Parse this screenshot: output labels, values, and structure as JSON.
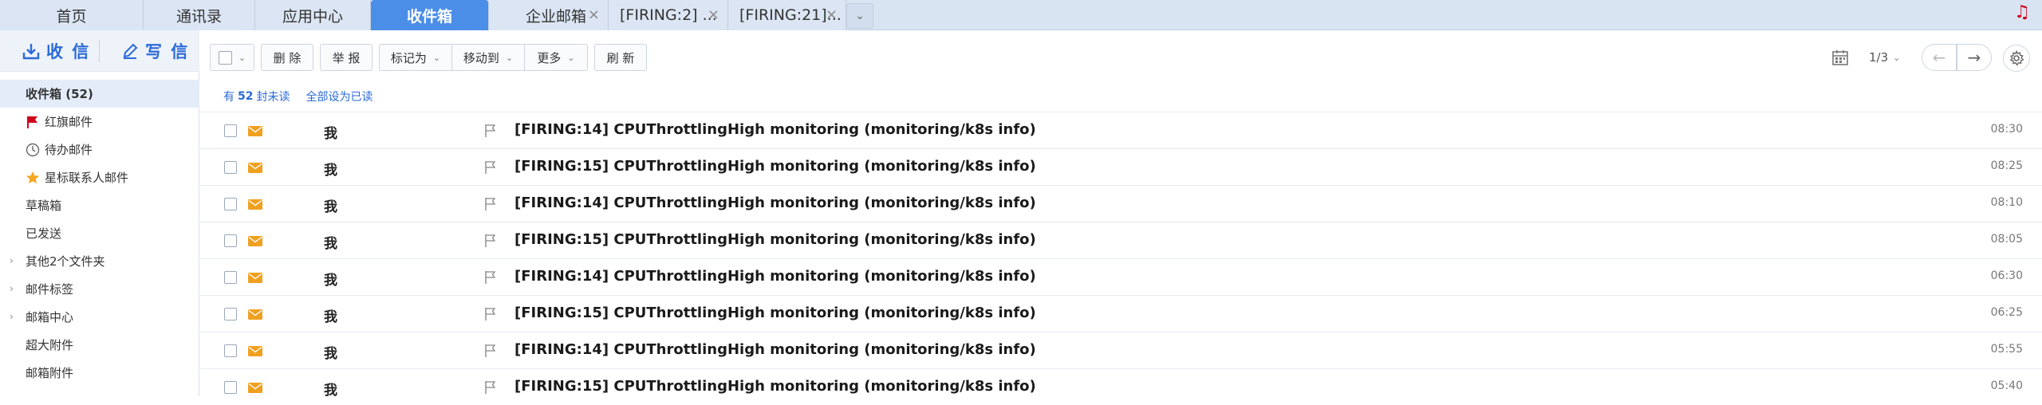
{
  "tabs": [
    {
      "label": "首页"
    },
    {
      "label": "通讯录"
    },
    {
      "label": "应用中心"
    },
    {
      "label": "收件箱"
    },
    {
      "label": "企业邮箱"
    },
    {
      "label": "[FIRING:2] ..."
    },
    {
      "label": "[FIRING:21]..."
    }
  ],
  "tab_close_glyph": "×",
  "compose": {
    "receive_label": "收 信",
    "write_label": "写 信"
  },
  "folders": [
    {
      "label": "收件箱 (52)"
    },
    {
      "label": "红旗邮件"
    },
    {
      "label": "待办邮件"
    },
    {
      "label": "星标联系人邮件"
    },
    {
      "label": "草稿箱"
    },
    {
      "label": "已发送"
    },
    {
      "label": "其他2个文件夹"
    },
    {
      "label": "邮件标签"
    },
    {
      "label": "邮箱中心"
    },
    {
      "label": "超大附件"
    },
    {
      "label": "邮箱附件"
    }
  ],
  "toolbar": {
    "delete_label": "删 除",
    "report_label": "举 报",
    "mark_as_label": "标记为",
    "move_to_label": "移动到",
    "more_label": "更多",
    "refresh_label": "刷 新"
  },
  "pager": {
    "label": "1/3"
  },
  "unread": {
    "prefix": "有",
    "count": "52",
    "suffix": "封未读",
    "mark_all_label": "全部设为已读"
  },
  "mails": [
    {
      "sender": "我",
      "subject": "[FIRING:14] CPUThrottlingHigh monitoring (monitoring/k8s info)",
      "time": "08:30"
    },
    {
      "sender": "我",
      "subject": "[FIRING:15] CPUThrottlingHigh monitoring (monitoring/k8s info)",
      "time": "08:25"
    },
    {
      "sender": "我",
      "subject": "[FIRING:14] CPUThrottlingHigh monitoring (monitoring/k8s info)",
      "time": "08:10"
    },
    {
      "sender": "我",
      "subject": "[FIRING:15] CPUThrottlingHigh monitoring (monitoring/k8s info)",
      "time": "08:05"
    },
    {
      "sender": "我",
      "subject": "[FIRING:14] CPUThrottlingHigh monitoring (monitoring/k8s info)",
      "time": "06:30"
    },
    {
      "sender": "我",
      "subject": "[FIRING:15] CPUThrottlingHigh monitoring (monitoring/k8s info)",
      "time": "06:25"
    },
    {
      "sender": "我",
      "subject": "[FIRING:14] CPUThrottlingHigh monitoring (monitoring/k8s info)",
      "time": "05:55"
    },
    {
      "sender": "我",
      "subject": "[FIRING:15] CPUThrottlingHigh monitoring (monitoring/k8s info)",
      "time": "05:40"
    }
  ],
  "colors": {
    "accent": "#4a8ee8",
    "link": "#2b6ad8",
    "flag_red": "#d0021b",
    "envelope": "#f0a020",
    "star": "#f5a623"
  },
  "icons": {
    "receive": "inbox-download-icon",
    "write": "pencil-icon",
    "red_flag": "red-flag-icon",
    "todo": "clock-icon",
    "star": "star-icon",
    "music": "music-note-icon",
    "calendar": "calendar-icon",
    "settings": "gear-icon",
    "envelope": "envelope-icon",
    "flag": "flag-outline-icon"
  }
}
